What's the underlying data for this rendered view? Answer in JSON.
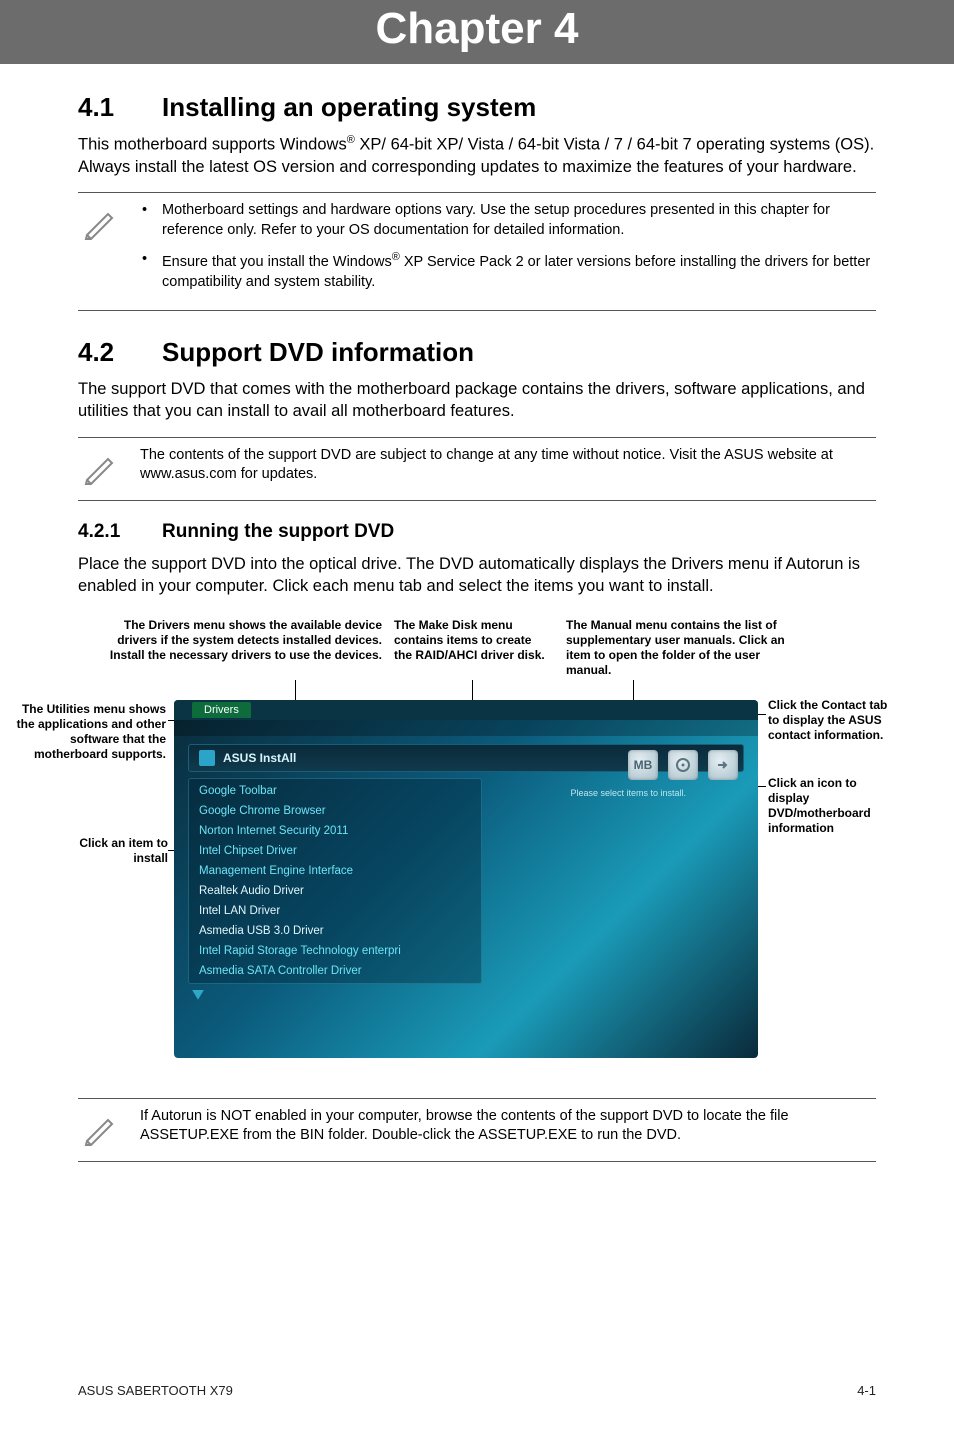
{
  "chapter": {
    "title": "Chapter 4"
  },
  "section41": {
    "heading_num": "4.1",
    "heading_text": "Installing an operating system",
    "para_a": "This motherboard supports Windows",
    "para_b": " XP/ 64-bit XP/ Vista / 64-bit Vista / 7 / 64-bit 7 operating systems (OS). Always install the latest OS version and corresponding updates to maximize the features of your hardware.",
    "note1": "Motherboard settings and hardware options vary. Use the setup procedures presented in this chapter for reference only. Refer to your OS documentation for detailed information.",
    "note2a": "Ensure that you install the Windows",
    "note2b": " XP Service Pack 2 or later versions before installing the drivers for better compatibility and system stability."
  },
  "section42": {
    "heading_num": "4.2",
    "heading_text": "Support DVD information",
    "para": "The support DVD that comes with the motherboard package contains the drivers, software applications, and utilities that you can install to avail all motherboard features.",
    "note": "The contents of the support DVD are subject to change at any time without notice. Visit the ASUS website at www.asus.com for updates."
  },
  "section421": {
    "heading_num": "4.2.1",
    "heading_text": "Running the support DVD",
    "para": "Place the support DVD into the optical drive. The DVD automatically displays the Drivers menu if Autorun is enabled in your computer. Click each menu tab and select the items you want to install."
  },
  "callouts": {
    "top1": "The Drivers menu shows the available device drivers if the system detects installed devices. Install the necessary drivers to use the devices.",
    "top2": "The Make Disk menu contains items to create the RAID/AHCI driver disk.",
    "top3": "The Manual menu contains the list of supplementary user manuals. Click an item to open the folder of the user manual.",
    "left1": "The Utilities menu shows the applications and other software that the motherboard supports.",
    "left2": "Click an item to install",
    "right1": "Click the Contact tab to display the ASUS contact information.",
    "right2": "Click an icon to display DVD/motherboard information"
  },
  "window": {
    "tab_drivers": "Drivers",
    "install_label": "ASUS InstAll",
    "badge_mb": "MB",
    "select_hint": "Please select items to install.",
    "items": [
      "Google Toolbar",
      "Google Chrome Browser",
      "Norton Internet Security 2011",
      "Intel Chipset Driver",
      "Management Engine Interface",
      "Realtek Audio Driver",
      "Intel LAN Driver",
      "Asmedia USB 3.0 Driver",
      "Intel Rapid Storage Technology enterpri",
      "Asmedia SATA Controller Driver"
    ]
  },
  "autorun_note": "If Autorun is NOT enabled in your computer, browse the contents of the support DVD to locate the file ASSETUP.EXE from the BIN folder. Double-click the ASSETUP.EXE to run the DVD.",
  "footer": {
    "left": "ASUS SABERTOOTH X79",
    "right": "4-1"
  }
}
